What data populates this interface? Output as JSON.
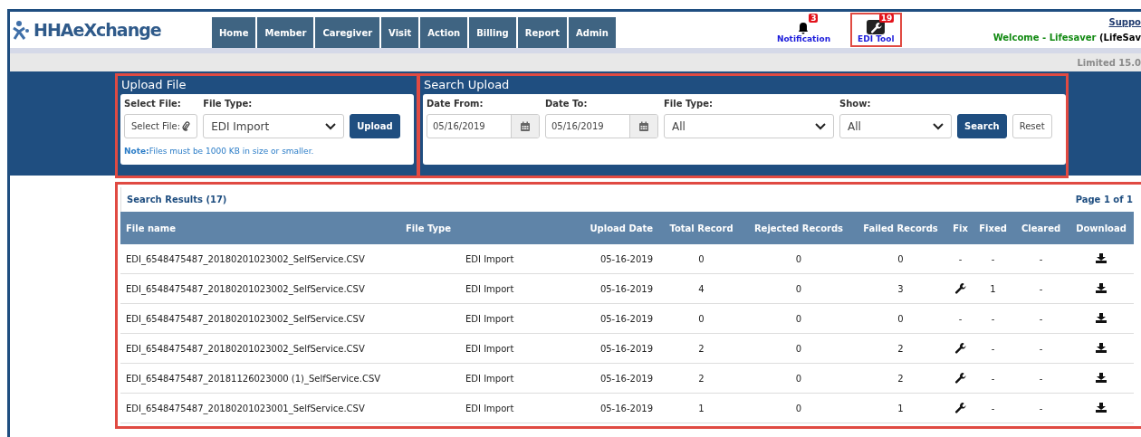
{
  "header": {
    "logo": "HHAeXchange",
    "nav": [
      "Home",
      "Member",
      "Caregiver",
      "Visit",
      "Action",
      "Billing",
      "Report",
      "Admin"
    ],
    "tools": [
      {
        "label": "Notification",
        "badge": "3",
        "kind": "bell",
        "selected": false
      },
      {
        "label": "EDI Tool",
        "badge": "19",
        "kind": "wrench",
        "selected": true
      }
    ],
    "support": "Suppo",
    "welcome": "Welcome - Lifesaver",
    "user": "(LifeSav",
    "version": "Limited 15.0"
  },
  "upload": {
    "title": "Upload File",
    "select_label": "Select File:",
    "select_button": "Select File:",
    "type_label": "File Type:",
    "type_value": "EDI Import",
    "upload_button": "Upload",
    "note_label": "Note:",
    "note": "Files must be 1000 KB in size or smaller."
  },
  "search": {
    "title": "Search Upload",
    "date_from_label": "Date From:",
    "date_from": "05/16/2019",
    "date_to_label": "Date To:",
    "date_to": "05/16/2019",
    "type_label": "File Type:",
    "type_value": "All",
    "show_label": "Show:",
    "show_value": "All",
    "search_button": "Search",
    "reset_button": "Reset"
  },
  "results": {
    "title": "Search Results (17)",
    "page": "Page 1 of 1",
    "columns": [
      "File name",
      "File Type",
      "Upload Date",
      "Total Record",
      "Rejected Records",
      "Failed Records",
      "Fix",
      "Fixed",
      "Cleared",
      "Download"
    ],
    "rows": [
      {
        "file": "EDI_6548475487_20180201023002_SelfService.CSV",
        "type": "EDI Import",
        "date": "05-16-2019",
        "total": "0",
        "rejected": "0",
        "failed": "0",
        "fix": {
          "kind": "dash",
          "text": "-"
        },
        "fixed": "-",
        "cleared": "-"
      },
      {
        "file": "EDI_6548475487_20180201023002_SelfService.CSV",
        "type": "EDI Import",
        "date": "05-16-2019",
        "total": "4",
        "rejected": "0",
        "failed": "3",
        "fix": {
          "kind": "wrench"
        },
        "fixed": "1",
        "cleared": "-"
      },
      {
        "file": "EDI_6548475487_20180201023002_SelfService.CSV",
        "type": "EDI Import",
        "date": "05-16-2019",
        "total": "0",
        "rejected": "0",
        "failed": "0",
        "fix": {
          "kind": "dash",
          "text": "-"
        },
        "fixed": "-",
        "cleared": "-"
      },
      {
        "file": "EDI_6548475487_20180201023002_SelfService.CSV",
        "type": "EDI Import",
        "date": "05-16-2019",
        "total": "2",
        "rejected": "0",
        "failed": "2",
        "fix": {
          "kind": "wrench"
        },
        "fixed": "-",
        "cleared": "-"
      },
      {
        "file": "EDI_6548475487_20181126023000 (1)_SelfService.CSV",
        "type": "EDI Import",
        "date": "05-16-2019",
        "total": "2",
        "rejected": "0",
        "failed": "2",
        "fix": {
          "kind": "wrench"
        },
        "fixed": "-",
        "cleared": "-"
      },
      {
        "file": "EDI_6548475487_20180201023001_SelfService.CSV",
        "type": "EDI Import",
        "date": "05-16-2019",
        "total": "1",
        "rejected": "0",
        "failed": "1",
        "fix": {
          "kind": "wrench"
        },
        "fixed": "-",
        "cleared": "-"
      }
    ]
  }
}
